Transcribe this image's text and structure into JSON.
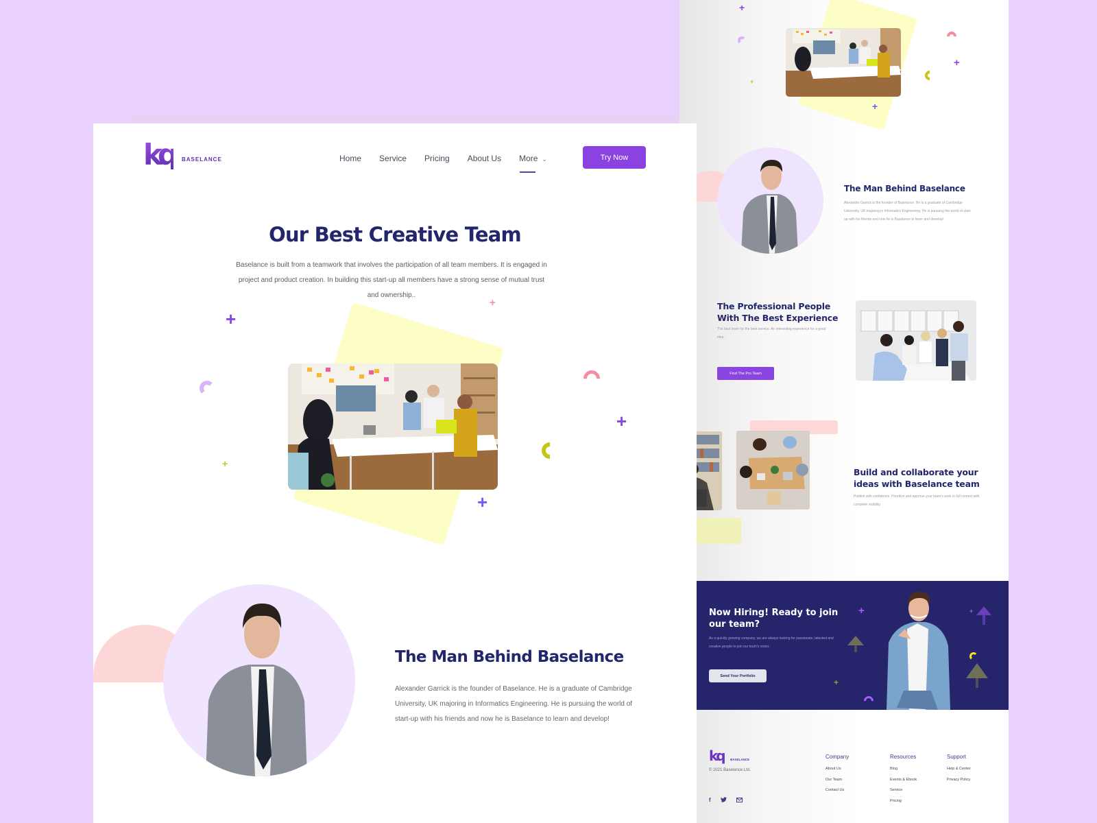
{
  "brand": {
    "name": "BASELANCE",
    "mark": "kq",
    "accent": "#8c42e0",
    "navy": "#23266b",
    "background": "#e8d2fd"
  },
  "nav": {
    "items": [
      {
        "label": "Home"
      },
      {
        "label": "Service"
      },
      {
        "label": "Pricing"
      },
      {
        "label": "About Us"
      },
      {
        "label": "More",
        "has_dropdown": true,
        "active": true
      }
    ],
    "cta": "Try Now"
  },
  "hero": {
    "title": "Our Best Creative Team",
    "description": "Baselance is built from a teamwork that involves the participation of all team members. It is engaged in project and product creation. In building this start-up all members have a strong sense of mutual trust and ownership..",
    "image_alt": "team-meeting-photo"
  },
  "founder": {
    "title": "The Man Behind Baselance",
    "description": "Alexander Garrick is the founder of Baselance. He is a graduate of Cambridge University, UK majoring in Informatics Engineering. He is pursuing the world of start-up with his friends and now he is Baselance to learn and develop!",
    "image_alt": "founder-portrait"
  },
  "preview": {
    "professional": {
      "title": "The Professional People With The Best Experience",
      "description": "The best team for the best service. An interesting experience for a good idea.",
      "button": "Find The Pro Team"
    },
    "collaborate": {
      "title": "Build and collaborate your ideas with Baselance team",
      "description": "Publish with confidence. Prioritize and approve your team's work in full context with complete visibility."
    },
    "hiring": {
      "title": "Now Hiring! Ready to join our team?",
      "description": "As a quickly growing company, we are always looking for passionate, talented and creative people to join our team's roster.",
      "button": "Send Your Portfolio"
    },
    "footer": {
      "copyright": "© 2021 Baselance Ltd.",
      "columns": [
        {
          "heading": "Company",
          "links": [
            "About Us",
            "Our Team",
            "Contact Us"
          ]
        },
        {
          "heading": "Resources",
          "links": [
            "Blog",
            "Events & Ebook",
            "Service",
            "Pricing"
          ]
        },
        {
          "heading": "Support",
          "links": [
            "Help & Center",
            "Privacy Policy"
          ]
        }
      ],
      "social": [
        {
          "icon": "facebook-icon",
          "glyph": "f"
        },
        {
          "icon": "twitter-icon",
          "glyph": "🐦"
        },
        {
          "icon": "mail-icon",
          "glyph": "✉"
        }
      ]
    }
  }
}
